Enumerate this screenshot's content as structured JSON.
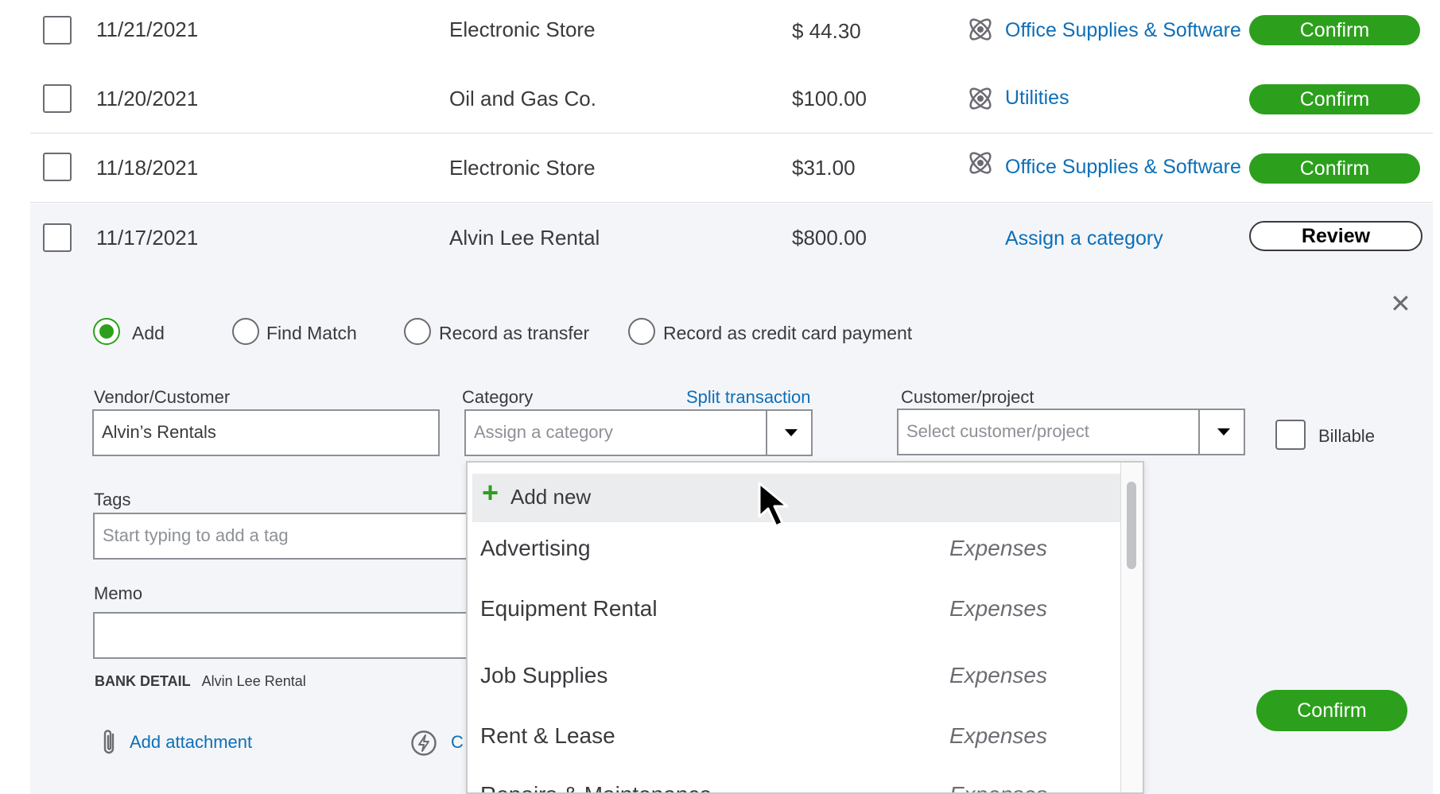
{
  "transactions": [
    {
      "date": "11/21/2021",
      "payee": "Electronic Store",
      "amount": "$ 44.30",
      "category": "Office Supplies & Software",
      "action": "Confirm"
    },
    {
      "date": "11/20/2021",
      "payee": "Oil and Gas Co.",
      "amount": "$100.00",
      "category": "Utilities",
      "action": "Confirm"
    },
    {
      "date": "11/18/2021",
      "payee": "Electronic Store",
      "amount": "$31.00",
      "category": "Office Supplies & Software",
      "action": "Confirm"
    },
    {
      "date": "11/17/2021",
      "payee": "Alvin Lee Rental",
      "amount": "$800.00",
      "category": "Assign a category",
      "action": "Review"
    }
  ],
  "icons": {
    "category": "ai-category-icon",
    "close": "close-icon",
    "attachment": "paperclip-icon",
    "rule": "lightning-icon",
    "cursor": "mouse-pointer-icon",
    "plus": "plus-icon"
  },
  "colors": {
    "accent_green": "#2ca01c",
    "link_blue": "#0d6fb8",
    "panel_bg": "#f4f5f8"
  },
  "detail": {
    "radios": [
      {
        "label": "Add",
        "selected": true
      },
      {
        "label": "Find Match",
        "selected": false
      },
      {
        "label": "Record as transfer",
        "selected": false
      },
      {
        "label": "Record as credit card payment",
        "selected": false
      }
    ],
    "vendor_label": "Vendor/Customer",
    "vendor_value": "Alvin’s Rentals",
    "category_label": "Category",
    "split_link": "Split transaction",
    "category_placeholder": "Assign a category",
    "customer_label": "Customer/project",
    "customer_placeholder": "Select customer/project",
    "billable_label": "Billable",
    "tags_label": "Tags",
    "tags_placeholder": "Start typing to add a tag",
    "memo_label": "Memo",
    "memo_value": "",
    "bank_detail_label": "BANK DETAIL",
    "bank_detail_value": "Alvin Lee Rental",
    "add_attachment": "Add attachment",
    "create_rule_partial": "C",
    "confirm_label": "Confirm"
  },
  "category_menu": {
    "add_new": "Add new",
    "items": [
      {
        "name": "Advertising",
        "type": "Expenses"
      },
      {
        "name": "Equipment Rental",
        "type": "Expenses"
      },
      {
        "name": "Job Supplies",
        "type": "Expenses"
      },
      {
        "name": "Rent & Lease",
        "type": "Expenses"
      },
      {
        "name": "Repairs & Maintenance",
        "type": "Expenses"
      }
    ]
  }
}
